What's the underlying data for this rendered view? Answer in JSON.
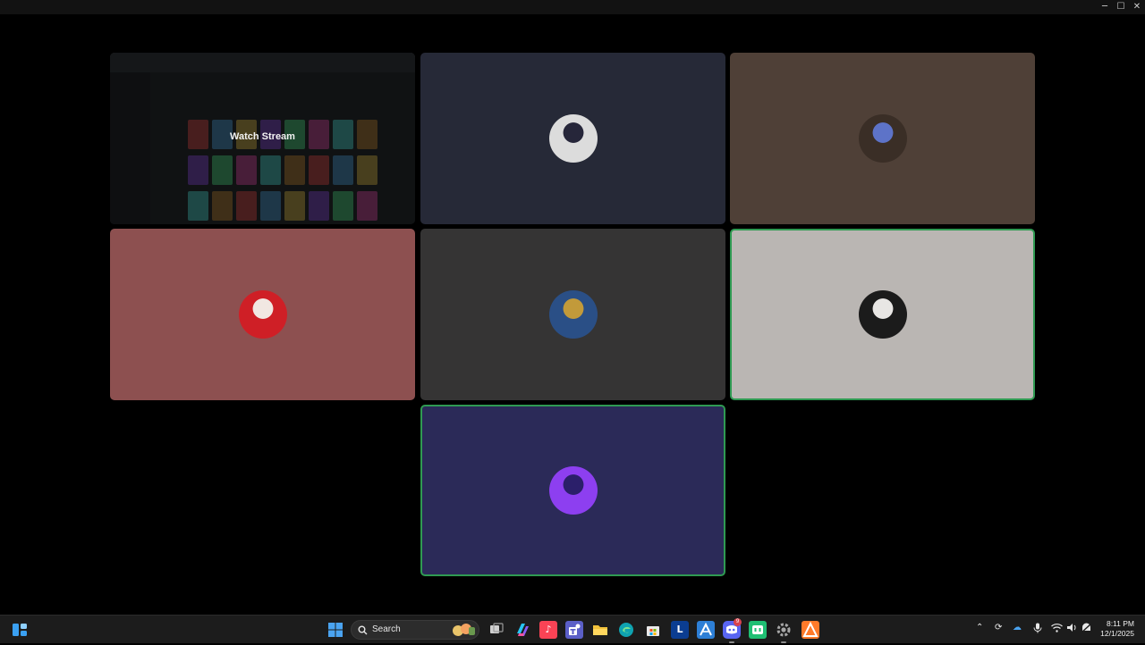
{
  "window": {
    "minimize_glyph": "─",
    "maximize_glyph": "☐",
    "close_glyph": "✕"
  },
  "stream_tile": {
    "label": "Watch Stream"
  },
  "participants": [
    {
      "id": "p1",
      "background": "#262937",
      "speaking": false,
      "avatar_colors": [
        "#dcdcdc",
        "#26263a"
      ]
    },
    {
      "id": "p2",
      "background": "#4f4037",
      "speaking": false,
      "avatar_colors": [
        "#3a2e26",
        "#5d73c8"
      ]
    },
    {
      "id": "p3",
      "background": "#8d5050",
      "speaking": false,
      "avatar_colors": [
        "#cf1f26",
        "#f1e7e2"
      ]
    },
    {
      "id": "p4",
      "background": "#353434",
      "speaking": false,
      "avatar_colors": [
        "#2a4f86",
        "#c29a3a"
      ]
    },
    {
      "id": "p5",
      "background": "#bab6b3",
      "speaking": true,
      "avatar_colors": [
        "#1b1b1b",
        "#e8e6e4"
      ]
    },
    {
      "id": "p6",
      "background": "#2b2a58",
      "speaking": true,
      "avatar_colors": [
        "#8d3ff0",
        "#2b1f6a"
      ]
    }
  ],
  "taskbar": {
    "search_placeholder": "Search",
    "discord_badge": "9",
    "clock_time": "8:11 PM",
    "clock_date": "12/1/2025",
    "notepad_letter": "L",
    "colors": {
      "start": "#4aa3f0",
      "copilot": "#8b5cf6",
      "music": "#fa4355",
      "teams": "#5b5fc7",
      "files": "#f2c23b",
      "edge": "#0fa3b1",
      "store": "#e9e9e9",
      "app_l": "#0b3d91",
      "app_a": "#2d7fd6",
      "discord": "#5865f2",
      "app_green": "#1fbf73",
      "settings": "#a7a7a7",
      "app_orange": "#ff7a2a"
    }
  }
}
